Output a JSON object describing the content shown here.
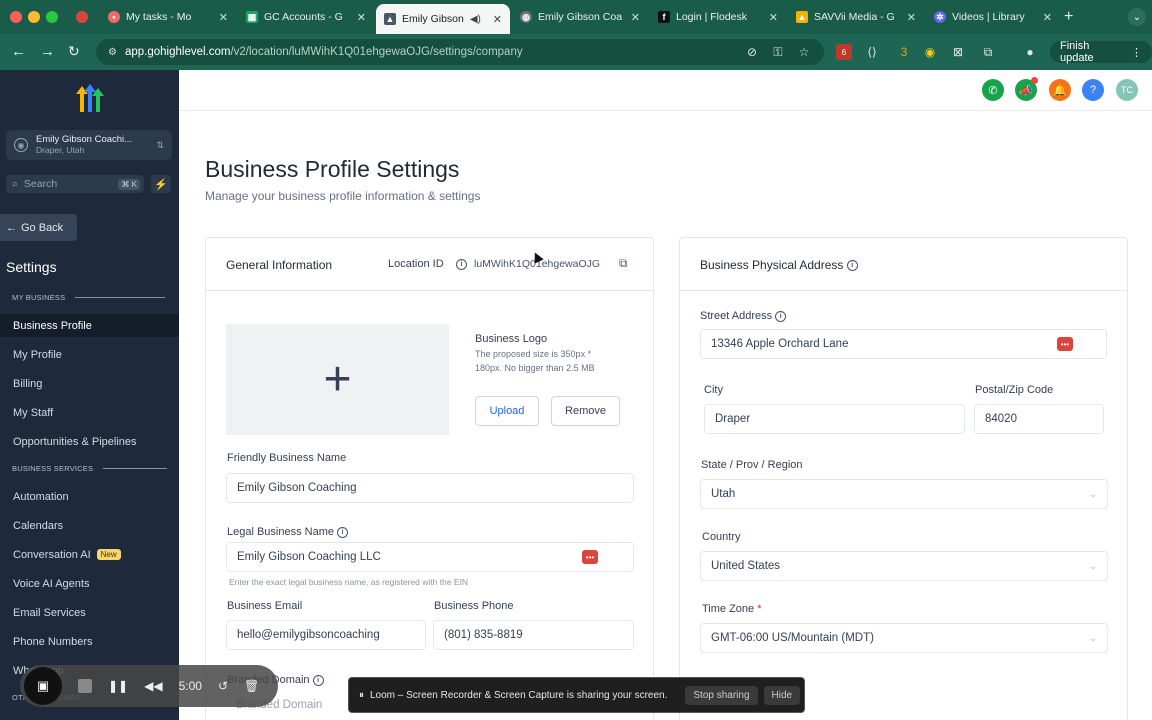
{
  "browser": {
    "tabs": [
      {
        "title": "",
        "favicon": "screen-record-icon"
      },
      {
        "title": "My tasks - Mo",
        "favicon": "asana-icon"
      },
      {
        "title": "GC Accounts - G",
        "favicon": "sheets-icon"
      },
      {
        "title": "Emily Gibson",
        "favicon": "ghl-icon"
      },
      {
        "title": "Emily Gibson Coa",
        "favicon": "globe-icon"
      },
      {
        "title": "Login | Flodesk",
        "favicon": "flodesk-icon"
      },
      {
        "title": "SAVVii Media - G",
        "favicon": "drive-icon"
      },
      {
        "title": "Videos | Library",
        "favicon": "gear-icon"
      }
    ],
    "url_host": "app.gohighlevel.com",
    "url_path": "/v2/location/luMWihK1Q01ehgewaOJG/settings/company",
    "finish_update": "Finish update",
    "ext_badge_1": "6",
    "ext_badge_2": "3"
  },
  "sidebar": {
    "account_name": "Emily Gibson Coachi...",
    "account_location": "Draper, Utah",
    "search_placeholder": "Search",
    "search_shortcut": "⌘ K",
    "go_back": "Go Back",
    "settings_title": "Settings",
    "section_my_business": "MY BUSINESS",
    "section_business_services": "BUSINESS SERVICES",
    "section_other": "OTHER SETTINGS",
    "items_my_business": [
      "Business Profile",
      "My Profile",
      "Billing",
      "My Staff",
      "Opportunities & Pipelines"
    ],
    "items_services": [
      "Automation",
      "Calendars",
      "Conversation AI",
      "Voice AI Agents",
      "Email Services",
      "Phone Numbers",
      "WhatsApp"
    ],
    "new_badge": "New"
  },
  "header": {
    "avatar_initials": "TC"
  },
  "page": {
    "title": "Business Profile Settings",
    "subtitle": "Manage your business profile information & settings"
  },
  "general": {
    "title": "General Information",
    "location_id_label": "Location ID",
    "location_id": "luMWihK1Q01ehgewaOJG",
    "logo_label": "Business Logo",
    "logo_hint_1": "The proposed size is 350px *",
    "logo_hint_2": "180px. No bigger than 2.5 MB",
    "upload": "Upload",
    "remove": "Remove",
    "friendly_name_label": "Friendly Business Name",
    "friendly_name": "Emily Gibson Coaching",
    "legal_name_label": "Legal Business Name",
    "legal_name": "Emily Gibson Coaching LLC",
    "legal_hint": "Enter the exact legal business name, as registered with the EIN",
    "email_label": "Business Email",
    "email": "hello@emilygibsoncoaching",
    "phone_label": "Business Phone",
    "phone": "(801) 835-8819",
    "domain_label": "Branded Domain",
    "domain_placeholder": "Branded Domain"
  },
  "address": {
    "title": "Business Physical Address",
    "street_label": "Street Address",
    "street": "13346 Apple Orchard Lane",
    "city_label": "City",
    "city": "Draper",
    "zip_label": "Postal/Zip Code",
    "zip": "84020",
    "state_label": "State / Prov / Region",
    "state": "Utah",
    "country_label": "Country",
    "country": "United States",
    "timezone_label": "Time Zone",
    "timezone_required": "*",
    "timezone": "GMT-06:00 US/Mountain (MDT)"
  },
  "loom": {
    "sharing_text": "Loom – Screen Recorder & Screen Capture is sharing your screen.",
    "stop_sharing": "Stop sharing",
    "hide": "Hide",
    "timer": "5:00"
  }
}
